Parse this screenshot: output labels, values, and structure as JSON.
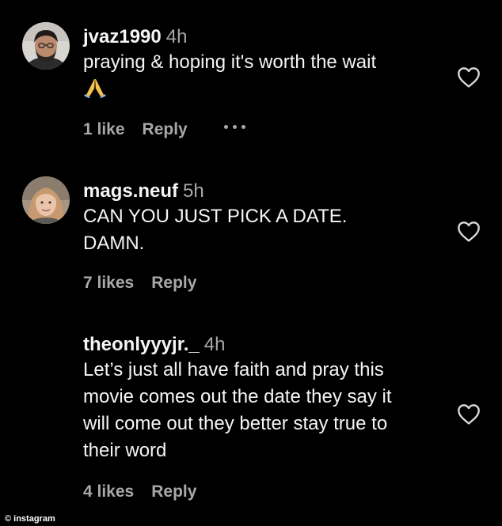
{
  "comments": [
    {
      "username": "jvaz1990",
      "time": "4h",
      "text": "praying & hoping it's worth the wait",
      "emoji": "folded-hands-emoji",
      "likes": "1 like",
      "reply": "Reply",
      "has_more": true
    },
    {
      "username": "mags.neuf",
      "time": "5h",
      "text": "CAN YOU JUST PICK A DATE.\nDAMN.",
      "likes": "7 likes",
      "reply": "Reply"
    },
    {
      "username": "theonlyyyjr._",
      "time": "4h",
      "text": "Let’s just all have faith and pray this\nmovie comes out the date they say it\nwill come out they better stay true to\ntheir word",
      "likes": "4 likes",
      "reply": "Reply"
    }
  ],
  "icons": {
    "like": "heart-outline-icon",
    "more": "ellipsis-icon"
  },
  "watermark": "© instagram",
  "colors": {
    "background": "#000000",
    "primary_text": "#f5f5f5",
    "secondary_text": "#a8a8a8"
  }
}
